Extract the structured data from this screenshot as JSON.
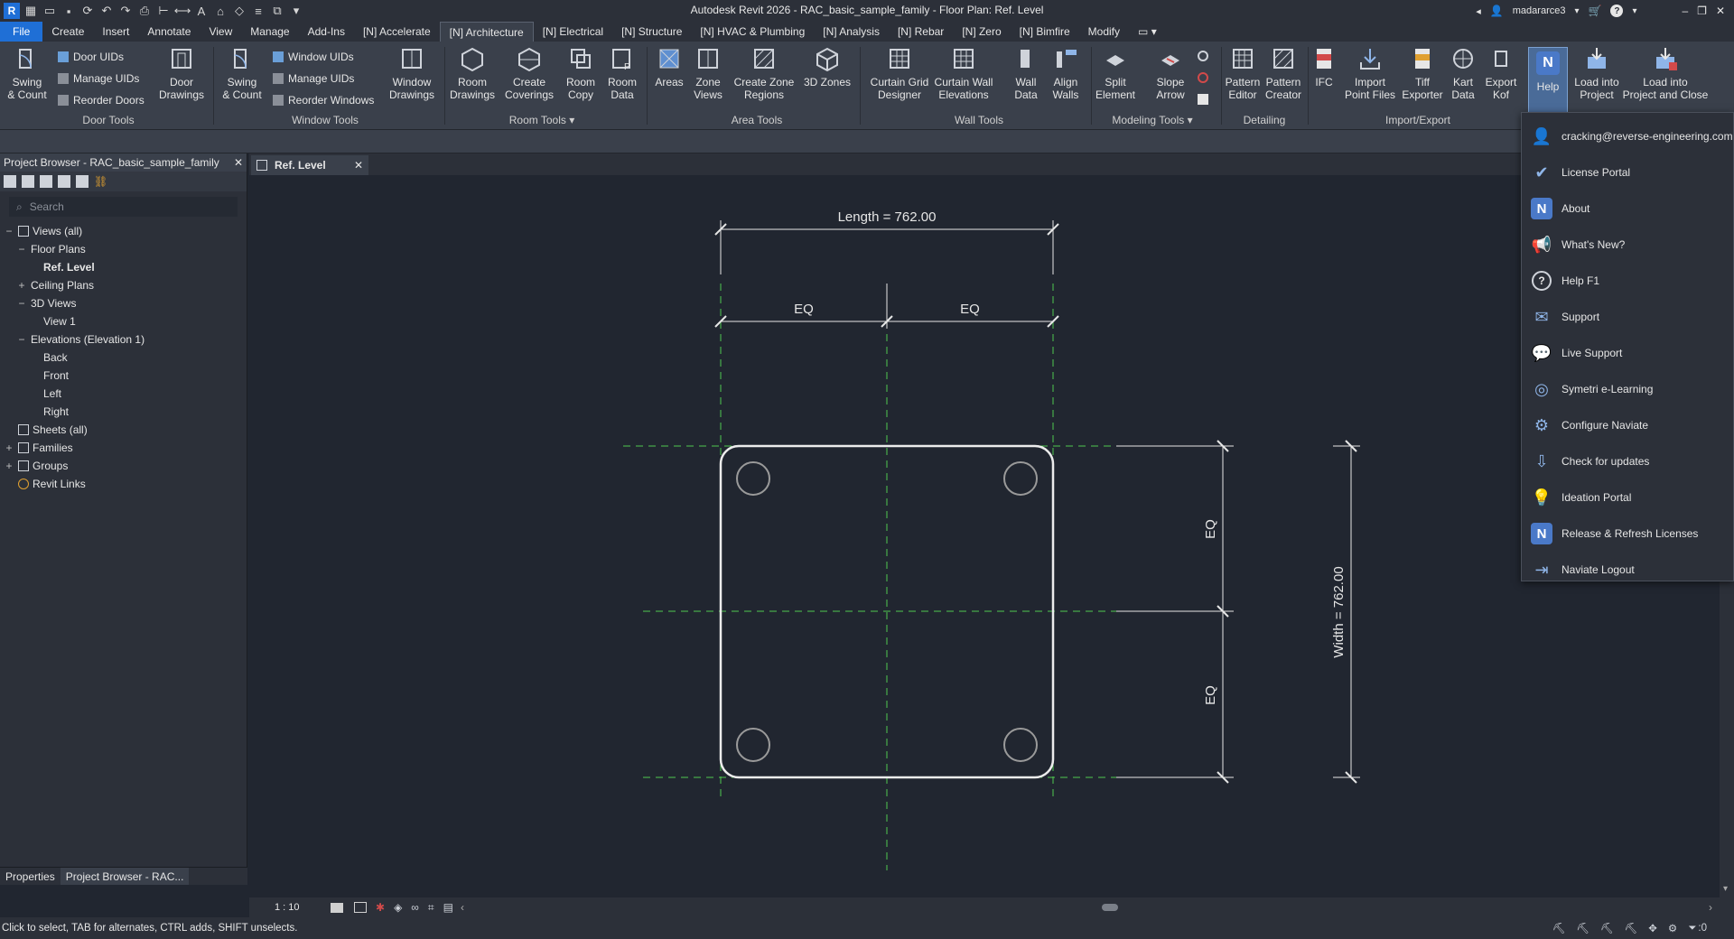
{
  "window": {
    "title": "Autodesk Revit 2026 - RAC_basic_sample_family - Floor Plan: Ref. Level",
    "user": "madararce3"
  },
  "ribbon_tabs": [
    "File",
    "Create",
    "Insert",
    "Annotate",
    "View",
    "Manage",
    "Add-Ins",
    "[N] Accelerate",
    "[N] Architecture",
    "[N] Electrical",
    "[N] Structure",
    "[N] HVAC & Plumbing",
    "[N] Analysis",
    "[N] Rebar",
    "[N] Zero",
    "[N] Bimfire",
    "Modify"
  ],
  "active_tab": "[N] Architecture",
  "ribbon": {
    "door_tools": {
      "label": "Door Tools",
      "swing": "Swing\n& Count",
      "door_uids": "Door UIDs",
      "manage_uids": "Manage UIDs",
      "reorder_doors": "Reorder Doors",
      "door_drawings": "Door\nDrawings"
    },
    "window_tools": {
      "label": "Window Tools",
      "swing": "Swing\n& Count",
      "window_uids": "Window UIDs",
      "manage_uids": "Manage UIDs",
      "reorder_windows": "Reorder Windows",
      "window_drawings": "Window\nDrawings"
    },
    "room_tools": {
      "label": "Room Tools",
      "room_drawings": "Room\nDrawings",
      "create_coverings": "Create\nCoverings",
      "room_copy": "Room\nCopy",
      "room_data": "Room\nData"
    },
    "area_tools": {
      "label": "Area Tools",
      "areas": "Areas",
      "zone_views": "Zone\nViews",
      "create_zone_regions": "Create Zone\nRegions",
      "3d_zones": "3D Zones"
    },
    "wall_tools": {
      "label": "Wall Tools",
      "curtain_grid_designer": "Curtain Grid\nDesigner",
      "curtain_wall_elevations": "Curtain Wall\nElevations",
      "wall_data": "Wall\nData",
      "align_walls": "Align\nWalls"
    },
    "modeling_tools": {
      "label": "Modeling Tools",
      "split_element": "Split\nElement",
      "slope_arrow": "Slope\nArrow"
    },
    "detailing": {
      "label": "Detailing",
      "pattern_editor": "Pattern\nEditor",
      "pattern_creator": "Pattern\nCreator"
    },
    "import_export": {
      "label": "Import/Export",
      "ifc": "IFC",
      "import_point_files": "Import\nPoint Files",
      "tiff_exporter": "Tiff\nExporter",
      "kart_data": "Kart\nData",
      "export_kof": "Export\nKof"
    },
    "help": "Help",
    "load_into_project": "Load into\nProject",
    "load_into_project_close": "Load into\nProject and Close"
  },
  "project_browser": {
    "title": "Project Browser - RAC_basic_sample_family",
    "search_placeholder": "Search",
    "tree": [
      {
        "label": "Views (all)",
        "level": 0,
        "exp": "−",
        "icon": "views-icon"
      },
      {
        "label": "Floor Plans",
        "level": 1,
        "exp": "−"
      },
      {
        "label": "Ref. Level",
        "level": 2,
        "exp": "",
        "selected": true
      },
      {
        "label": "Ceiling Plans",
        "level": 1,
        "exp": "+"
      },
      {
        "label": "3D Views",
        "level": 1,
        "exp": "−"
      },
      {
        "label": "View 1",
        "level": 2,
        "exp": ""
      },
      {
        "label": "Elevations (Elevation 1)",
        "level": 1,
        "exp": "−"
      },
      {
        "label": "Back",
        "level": 2,
        "exp": ""
      },
      {
        "label": "Front",
        "level": 2,
        "exp": ""
      },
      {
        "label": "Left",
        "level": 2,
        "exp": ""
      },
      {
        "label": "Right",
        "level": 2,
        "exp": ""
      },
      {
        "label": "Sheets (all)",
        "level": 0,
        "exp": "",
        "icon": "sheets-icon"
      },
      {
        "label": "Families",
        "level": 0,
        "exp": "+",
        "icon": "families-icon"
      },
      {
        "label": "Groups",
        "level": 0,
        "exp": "+",
        "icon": "groups-icon"
      },
      {
        "label": "Revit Links",
        "level": 0,
        "exp": "",
        "icon": "links-icon"
      }
    ],
    "bottom_tabs": [
      "Properties",
      "Project Browser - RAC..."
    ]
  },
  "view_tab": "Ref. Level",
  "drawing": {
    "length_label": "Length = 762.00",
    "width_label": "Width = 762.00",
    "eq": "EQ"
  },
  "view_control": {
    "scale": "1 : 10"
  },
  "status": {
    "text": "Click to select, TAB for alternates, CTRL adds, SHIFT unselects.",
    "filter_count": ":0"
  },
  "help_menu": [
    {
      "label": "cracking@reverse-engineering.com",
      "icon": "user-icon"
    },
    {
      "label": "License Portal",
      "icon": "license-icon"
    },
    {
      "label": "About",
      "icon": "naviate-icon"
    },
    {
      "label": "What's New?",
      "icon": "megaphone-icon"
    },
    {
      "label": "Help F1",
      "icon": "question-icon"
    },
    {
      "label": "Support",
      "icon": "mail-icon"
    },
    {
      "label": "Live Support",
      "icon": "chat-icon"
    },
    {
      "label": "Symetri e-Learning",
      "icon": "elearning-icon"
    },
    {
      "label": "Configure Naviate",
      "icon": "gear-icon"
    },
    {
      "label": "Check for updates",
      "icon": "download-icon"
    },
    {
      "label": "Ideation Portal",
      "icon": "bulb-icon"
    },
    {
      "label": "Release & Refresh Licenses",
      "icon": "naviate-icon"
    },
    {
      "label": "Naviate Logout",
      "icon": "logout-icon"
    }
  ]
}
